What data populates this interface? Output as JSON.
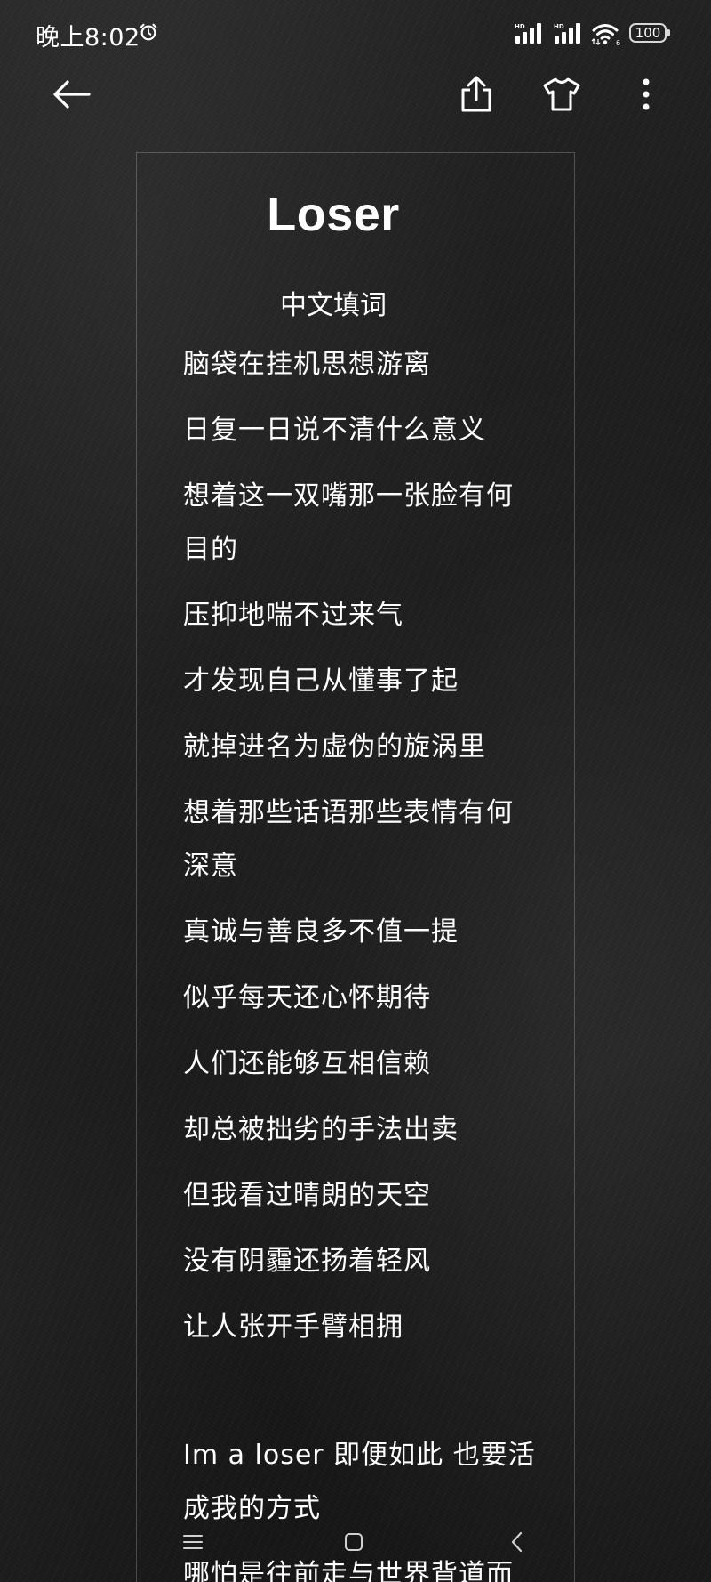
{
  "status_bar": {
    "time": "晚上8:02",
    "battery": "100",
    "icons": [
      "alarm-icon",
      "signal-hd-icon",
      "signal-hd-icon",
      "wifi-icon",
      "battery-icon"
    ]
  },
  "toolbar": {
    "icons": [
      "back-arrow-icon",
      "share-icon",
      "tshirt-theme-icon",
      "more-vertical-icon"
    ]
  },
  "note": {
    "title": "Loser",
    "subtitle": "中文填词",
    "lines": [
      "脑袋在挂机思想游离",
      "日复一日说不清什么意义",
      "想着这一双嘴那一张脸有何目的",
      "压抑地喘不过来气",
      "才发现自己从懂事了起",
      "就掉进名为虚伪的旋涡里",
      "想着那些话语那些表情有何深意",
      "真诚与善良多不值一提",
      "似乎每天还心怀期待",
      "人们还能够互相信赖",
      "却总被拙劣的手法出卖",
      "但我看过晴朗的天空",
      "没有阴霾还扬着轻风",
      "让人张开手臂相拥"
    ],
    "lines_after_gap": [
      "Im a loser 即便如此 也要活成我的方式",
      "哪怕是往前走与世界背道而"
    ]
  },
  "nav_bar": {
    "icons": [
      "menu-icon",
      "home-square-icon",
      "back-chevron-icon"
    ]
  },
  "colors": {
    "background": "#1e1e1e",
    "text": "#ffffff",
    "card_border": "rgba(255,255,255,0.22)"
  }
}
